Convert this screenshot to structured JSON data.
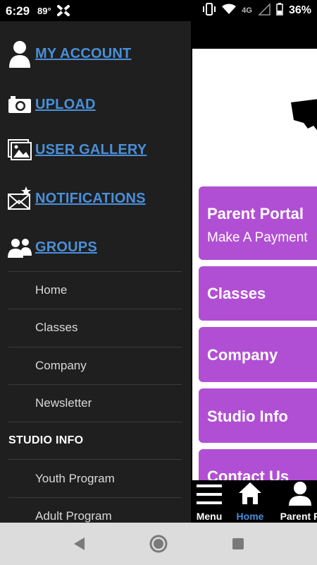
{
  "status_bar": {
    "time": "6:29",
    "temperature": "89°",
    "battery": "36%",
    "network": "4G"
  },
  "drawer": {
    "account_items": [
      {
        "label": "MY ACCOUNT",
        "icon": "user-icon"
      },
      {
        "label": "UPLOAD",
        "icon": "camera-icon"
      },
      {
        "label": "USER GALLERY",
        "icon": "gallery-icon"
      },
      {
        "label": "NOTIFICATIONS",
        "icon": "mail-star-icon"
      },
      {
        "label": "GROUPS",
        "icon": "group-icon"
      }
    ],
    "nav": [
      {
        "label": "Home"
      },
      {
        "label": "Classes"
      },
      {
        "label": "Company"
      },
      {
        "label": "Newsletter"
      }
    ],
    "section_header": "STUDIO INFO",
    "section_items": [
      {
        "label": "Youth Program"
      },
      {
        "label": "Adult Program"
      }
    ]
  },
  "main": {
    "tiles": [
      {
        "title": "Parent Portal",
        "subtitle": "Make A Payment"
      },
      {
        "title": "Classes"
      },
      {
        "title": "Company"
      },
      {
        "title": "Studio Info"
      },
      {
        "title": "Contact Us"
      }
    ],
    "tile_color": "#b14fd4"
  },
  "tabs": [
    {
      "label": "Menu",
      "icon": "menu-icon"
    },
    {
      "label": "Home",
      "icon": "home-icon",
      "active": true
    },
    {
      "label": "Parent P",
      "icon": "user-icon"
    }
  ],
  "colors": {
    "link": "#4a8fd9",
    "drawer_bg": "#1f1f1f"
  }
}
